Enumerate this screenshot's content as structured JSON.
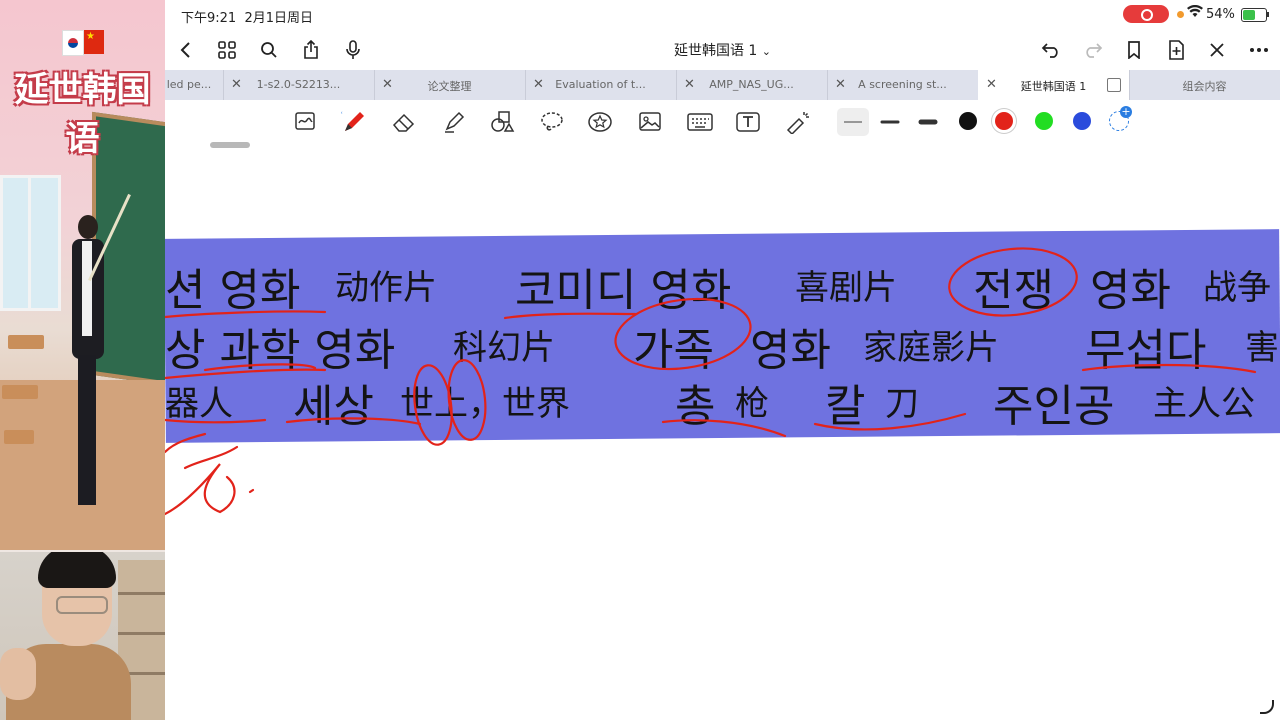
{
  "stream": {
    "brand_title": "延世韩国语"
  },
  "status_bar": {
    "time": "下午9:21",
    "date": "2月1日周日",
    "battery": "54%",
    "battery_level": 0.54
  },
  "toolbar": {
    "doc_title": "延世韩国语 1",
    "chevron": "⌄"
  },
  "tabs": [
    {
      "label": "led pe..."
    },
    {
      "label": "1-s2.0-S2213..."
    },
    {
      "label": "论文整理"
    },
    {
      "label": "Evaluation of t..."
    },
    {
      "label": "AMP_NAS_UG..."
    },
    {
      "label": "A screening st..."
    },
    {
      "label": "延世韩国语 1"
    },
    {
      "label": "组会内容"
    }
  ],
  "colors": {
    "accent_red": "#e2231a",
    "black": "#111111",
    "green": "#22dd22",
    "blue": "#2a4bdc",
    "band": "#6f72e0"
  },
  "page_rows": [
    [
      "션 영화",
      "动作片",
      "코미디 영화",
      "喜剧片",
      "전쟁",
      "영화",
      "战争"
    ],
    [
      "상 과학 영화",
      "科幻片",
      "가족",
      "영화",
      "家庭影片",
      "무섭다",
      "害"
    ],
    [
      "器人",
      "세상",
      "世上，世界",
      "총",
      "枪",
      "칼",
      "刀",
      "주인공",
      "主人公"
    ]
  ]
}
